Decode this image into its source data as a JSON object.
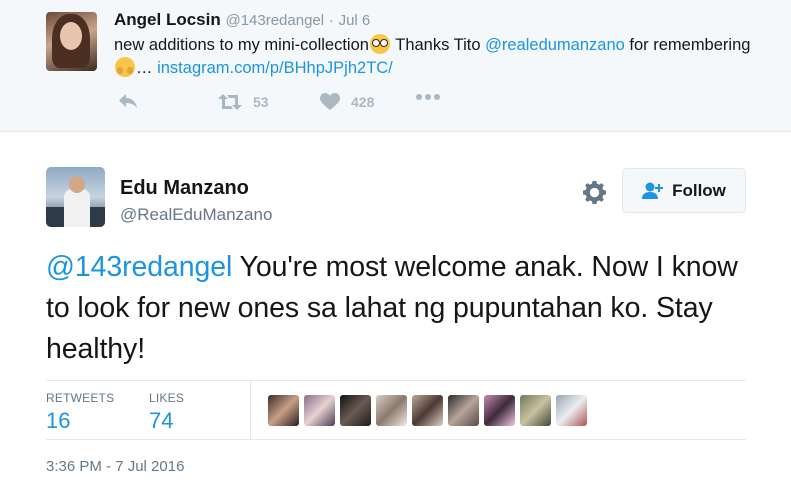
{
  "parent_tweet": {
    "author_name": "Angel Locsin",
    "handle": "@143redangel",
    "separator": "·",
    "date": "Jul 6",
    "text_part1": "new additions to my mini-collection",
    "text_part2": " Thanks Tito ",
    "mention": "@realedumanzano",
    "text_part3": " for remembering",
    "ellipsis": "… ",
    "link": "instagram.com/p/BHhpJPjh2TC/",
    "retweet_count": "53",
    "like_count": "428"
  },
  "tweet": {
    "author_name": "Edu Manzano",
    "handle": "@RealEduManzano",
    "follow_label": "Follow",
    "reply_mention": "@143redangel",
    "text": " You're most welcome anak. Now I know to look for new ones sa lahat ng pupuntahan ko. Stay healthy!",
    "stats": {
      "retweets_label": "RETWEETS",
      "retweets_value": "16",
      "likes_label": "LIKES",
      "likes_value": "74"
    },
    "timestamp": "3:36 PM - 7 Jul 2016"
  },
  "colors": {
    "link_blue": "#1b95e0",
    "muted_gray": "#8899a6",
    "action_gray": "#aab8c2",
    "parent_bg": "#f5f8fa"
  },
  "icons": {
    "reply": "reply-icon",
    "retweet": "retweet-icon",
    "like": "heart-icon",
    "more": "more-icon",
    "settings": "gear-icon",
    "follow": "add-user-icon",
    "emoji1": "nerd-face-emoji",
    "emoji2": "hugging-face-emoji"
  }
}
